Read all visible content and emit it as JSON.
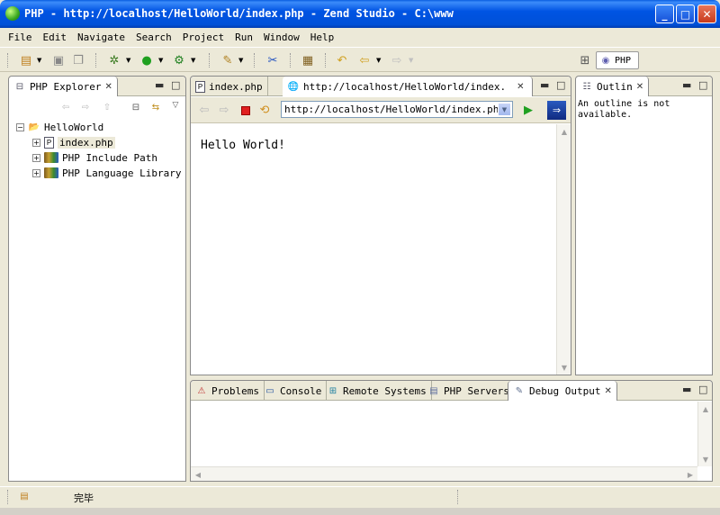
{
  "window": {
    "title": "PHP - http://localhost/HelloWorld/index.php - Zend Studio - C:\\www",
    "minimize": "_",
    "maximize": "□",
    "close": "✕"
  },
  "menu": [
    "File",
    "Edit",
    "Navigate",
    "Search",
    "Project",
    "Run",
    "Window",
    "Help"
  ],
  "toolbar": {
    "perspective_label": "PHP"
  },
  "explorer": {
    "tab_label": "PHP Explorer",
    "tree": {
      "project": "HelloWorld",
      "children": [
        "index.php",
        "PHP Include Path",
        "PHP Language Library"
      ]
    }
  },
  "editor": {
    "tabs": [
      "index.php",
      "http://localhost/HelloWorld/index."
    ],
    "url": "http://localhost/HelloWorld/index.php",
    "page_content": "Hello World!"
  },
  "outline": {
    "tab_label": "Outlin",
    "message": "An outline is not available."
  },
  "bottom_panel": {
    "tabs": [
      "Problems",
      "Console",
      "Remote Systems",
      "PHP Servers",
      "Debug Output"
    ]
  },
  "status": {
    "text": "完毕"
  },
  "colors": {
    "titlebar": "#0054e3",
    "chrome": "#ece9d8",
    "stop_red": "#e02020",
    "go_green": "#20a020"
  }
}
